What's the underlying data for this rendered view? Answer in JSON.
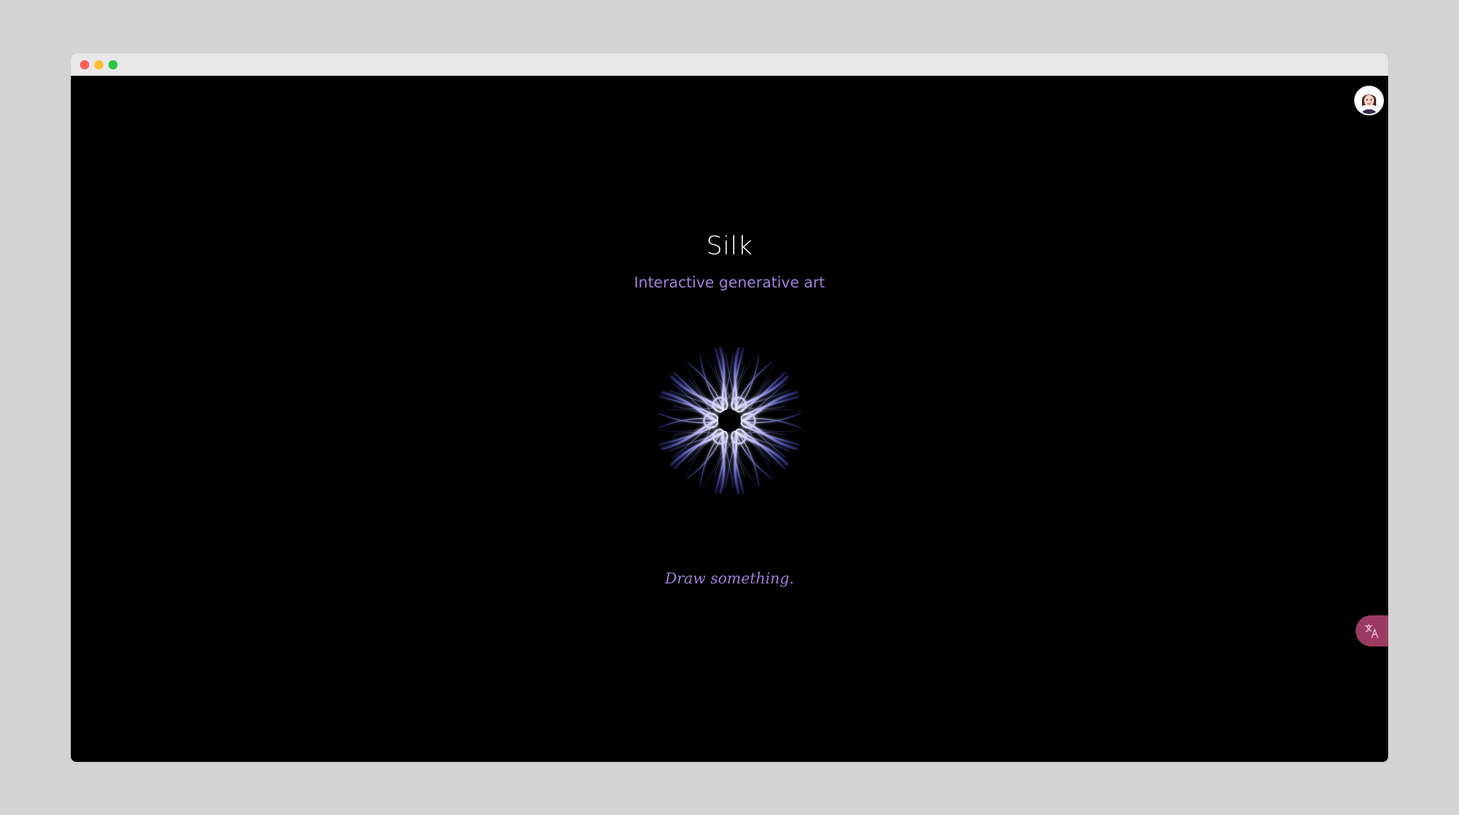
{
  "page": {
    "title": "Silk",
    "subtitle": "Interactive generative art",
    "hint": "Draw something."
  },
  "icons": {
    "avatar": "user-avatar-icon",
    "translate": "translate-icon"
  },
  "colors": {
    "background": "#000000",
    "accent": "#9d7fd6",
    "title": "#ffffff",
    "translate_button": "#9b3b63"
  }
}
